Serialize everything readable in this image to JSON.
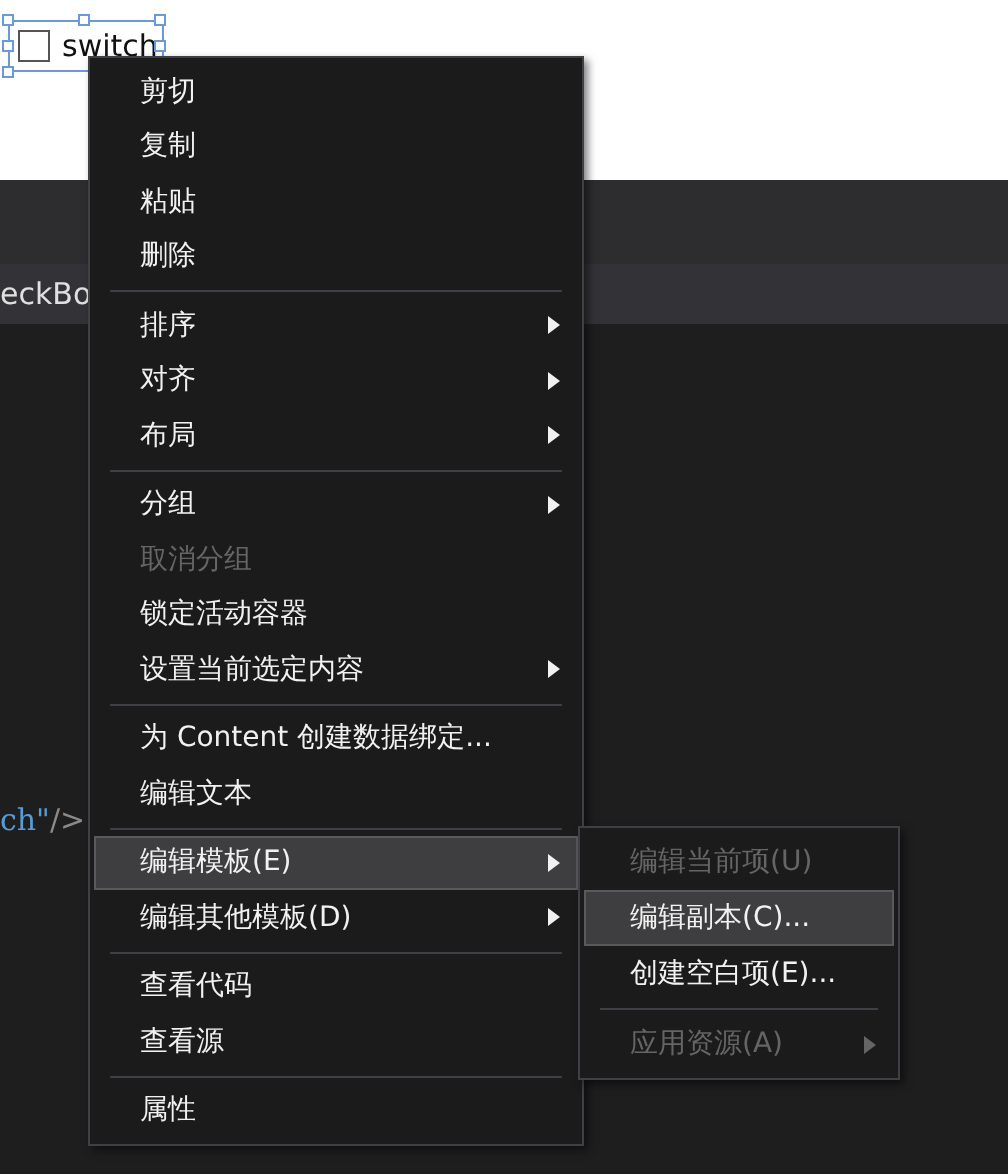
{
  "designer": {
    "checkbox": {
      "label": "switch",
      "checked": false
    }
  },
  "editor_tab": {
    "label": "eckBo"
  },
  "code_line": {
    "value": "ch\"",
    "tail": "/>"
  },
  "context_menu": {
    "groups": [
      {
        "items": [
          {
            "label": "剪切",
            "disabled": false,
            "has_submenu": false,
            "selected": false
          },
          {
            "label": "复制",
            "disabled": false,
            "has_submenu": false,
            "selected": false
          },
          {
            "label": "粘贴",
            "disabled": false,
            "has_submenu": false,
            "selected": false
          },
          {
            "label": "删除",
            "disabled": false,
            "has_submenu": false,
            "selected": false
          }
        ]
      },
      {
        "items": [
          {
            "label": "排序",
            "disabled": false,
            "has_submenu": true,
            "selected": false
          },
          {
            "label": "对齐",
            "disabled": false,
            "has_submenu": true,
            "selected": false
          },
          {
            "label": "布局",
            "disabled": false,
            "has_submenu": true,
            "selected": false
          }
        ]
      },
      {
        "items": [
          {
            "label": "分组",
            "disabled": false,
            "has_submenu": true,
            "selected": false
          },
          {
            "label": "取消分组",
            "disabled": true,
            "has_submenu": false,
            "selected": false
          },
          {
            "label": "锁定活动容器",
            "disabled": false,
            "has_submenu": false,
            "selected": false
          },
          {
            "label": "设置当前选定内容",
            "disabled": false,
            "has_submenu": true,
            "selected": false
          }
        ]
      },
      {
        "items": [
          {
            "label": "为 Content 创建数据绑定...",
            "disabled": false,
            "has_submenu": false,
            "selected": false
          },
          {
            "label": "编辑文本",
            "disabled": false,
            "has_submenu": false,
            "selected": false
          }
        ]
      },
      {
        "items": [
          {
            "label": "编辑模板(E)",
            "disabled": false,
            "has_submenu": true,
            "selected": true
          },
          {
            "label": "编辑其他模板(D)",
            "disabled": false,
            "has_submenu": true,
            "selected": false
          }
        ]
      },
      {
        "items": [
          {
            "label": "查看代码",
            "disabled": false,
            "has_submenu": false,
            "selected": false
          },
          {
            "label": "查看源",
            "disabled": false,
            "has_submenu": false,
            "selected": false
          }
        ]
      },
      {
        "items": [
          {
            "label": "属性",
            "disabled": false,
            "has_submenu": false,
            "selected": false
          }
        ]
      }
    ]
  },
  "submenu": {
    "groups": [
      {
        "items": [
          {
            "label": "编辑当前项(U)",
            "disabled": true,
            "has_submenu": false,
            "selected": false
          },
          {
            "label": "编辑副本(C)...",
            "disabled": false,
            "has_submenu": false,
            "selected": true
          },
          {
            "label": "创建空白项(E)...",
            "disabled": false,
            "has_submenu": false,
            "selected": false
          }
        ]
      },
      {
        "items": [
          {
            "label": "应用资源(A)",
            "disabled": true,
            "has_submenu": true,
            "selected": false
          }
        ]
      }
    ]
  }
}
